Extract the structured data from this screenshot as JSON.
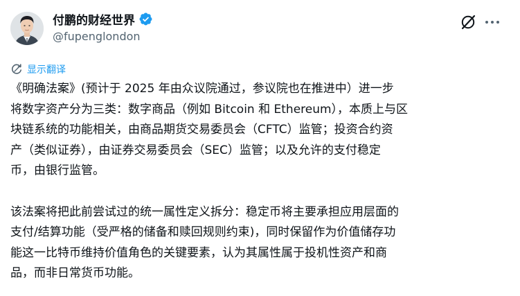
{
  "author": {
    "display_name": "付鹏的财经世界",
    "handle": "@fupenglondon",
    "verified": true,
    "verified_color": "#1d9bf0"
  },
  "actions": {
    "grok_icon": "grok-icon",
    "more_icon": "more-icon"
  },
  "translate": {
    "label": "显示翻译",
    "icon": "translate-icon"
  },
  "tweet": {
    "paragraph_1": [
      "《明确法案》(预计于 2025 年由众议院通过，参议院也在推进中）进一步",
      "将数字资产分为三类：数字商品（例如 Bitcoin 和 Ethereum），本质上与区",
      "块链系统的功能相关，由商品期货交易委员会（CFTC）监管；投资合约资",
      "产（类似证券），由证券交易委员会（SEC）监管；以及允许的支付稳定",
      "币，由银行监管。"
    ],
    "paragraph_2": [
      "该法案将把此前尝试过的统一属性定义拆分：稳定币将主要承担应用层面的",
      "支付/结算功能（受严格的储备和赎回规则约束)，同时保留作为价值储存功",
      "能这一比特币维持价值角色的关键要素，认为其属性属于投机性资产和商",
      "品，而非日常货币功能。"
    ]
  },
  "colors": {
    "text": "#0f1419",
    "secondary": "#536471",
    "accent": "#1d9bf0"
  }
}
